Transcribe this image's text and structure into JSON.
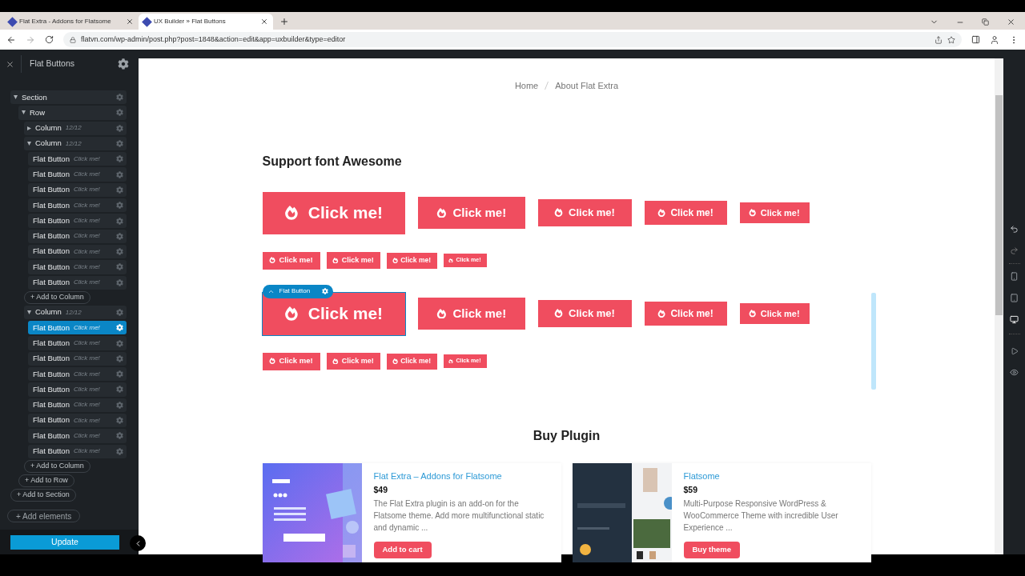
{
  "browser": {
    "tabs": [
      {
        "title": "Flat Extra - Addons for Flatsome",
        "selected": false
      },
      {
        "title": "UX Builder » Flat Buttons",
        "selected": true
      }
    ],
    "url": "flatvn.com/wp-admin/post.php?post=1848&action=edit&app=uxbuilder&type=editor"
  },
  "sidebar": {
    "title": "Flat Buttons",
    "tree": [
      {
        "label": "Section",
        "selected": false,
        "expanded": true,
        "add_label": "+ Add to Section",
        "children": [
          {
            "label": "Row",
            "selected": false,
            "expanded": true,
            "add_label": "+ Add to Row",
            "children": [
              {
                "label": "Column",
                "meta": "12/12",
                "selected": false,
                "expanded": false
              },
              {
                "label": "Column",
                "meta": "12/12",
                "selected": false,
                "expanded": true,
                "add_label": "+ Add to Column",
                "children": [
                  {
                    "label": "Flat Button",
                    "meta": "Click me!",
                    "selected": false
                  },
                  {
                    "label": "Flat Button",
                    "meta": "Click me!",
                    "selected": false
                  },
                  {
                    "label": "Flat Button",
                    "meta": "Click me!",
                    "selected": false
                  },
                  {
                    "label": "Flat Button",
                    "meta": "Click me!",
                    "selected": false
                  },
                  {
                    "label": "Flat Button",
                    "meta": "Click me!",
                    "selected": false
                  },
                  {
                    "label": "Flat Button",
                    "meta": "Click me!",
                    "selected": false
                  },
                  {
                    "label": "Flat Button",
                    "meta": "Click me!",
                    "selected": false
                  },
                  {
                    "label": "Flat Button",
                    "meta": "Click me!",
                    "selected": false
                  },
                  {
                    "label": "Flat Button",
                    "meta": "Click me!",
                    "selected": false
                  }
                ]
              },
              {
                "label": "Column",
                "meta": "12/12",
                "selected": false,
                "expanded": true,
                "add_label": "+ Add to Column",
                "children": [
                  {
                    "label": "Flat Button",
                    "meta": "Click me!",
                    "selected": true
                  },
                  {
                    "label": "Flat Button",
                    "meta": "Click me!",
                    "selected": false
                  },
                  {
                    "label": "Flat Button",
                    "meta": "Click me!",
                    "selected": false
                  },
                  {
                    "label": "Flat Button",
                    "meta": "Click me!",
                    "selected": false
                  },
                  {
                    "label": "Flat Button",
                    "meta": "Click me!",
                    "selected": false
                  },
                  {
                    "label": "Flat Button",
                    "meta": "Click me!",
                    "selected": false
                  },
                  {
                    "label": "Flat Button",
                    "meta": "Click me!",
                    "selected": false
                  },
                  {
                    "label": "Flat Button",
                    "meta": "Click me!",
                    "selected": false
                  },
                  {
                    "label": "Flat Button",
                    "meta": "Click me!",
                    "selected": false
                  }
                ]
              }
            ]
          }
        ]
      }
    ],
    "add_elements": "+ Add elements",
    "update_button": "Update"
  },
  "canvas": {
    "breadcrumb": [
      "Home",
      "About Flat Extra"
    ],
    "heading": "Support font Awesome",
    "selection_label": "Flat Button",
    "button_groups": [
      {
        "large_buttons": [
          {
            "label": "Click me!",
            "selected": false
          },
          {
            "label": "Click me!",
            "selected": false
          },
          {
            "label": "Click me!",
            "selected": false
          },
          {
            "label": "Click me!",
            "selected": false
          },
          {
            "label": "Click me!",
            "selected": false
          }
        ],
        "small_buttons": [
          {
            "label": "Click me!",
            "selected": false
          },
          {
            "label": "Click me!",
            "selected": false
          },
          {
            "label": "Click me!",
            "selected": false
          },
          {
            "label": "Click me!",
            "selected": false
          }
        ]
      },
      {
        "large_buttons": [
          {
            "label": "Click me!",
            "selected": true
          },
          {
            "label": "Click me!",
            "selected": false
          },
          {
            "label": "Click me!",
            "selected": false
          },
          {
            "label": "Click me!",
            "selected": false
          },
          {
            "label": "Click me!",
            "selected": false
          }
        ],
        "small_buttons": [
          {
            "label": "Click me!",
            "selected": false
          },
          {
            "label": "Click me!",
            "selected": false
          },
          {
            "label": "Click me!",
            "selected": false
          },
          {
            "label": "Click me!",
            "selected": false
          }
        ]
      }
    ],
    "buy_heading": "Buy Plugin",
    "products": [
      {
        "title": "Flat Extra – Addons for Flatsome",
        "price": "$49",
        "description": "The Flat Extra plugin is an add-on for the Flatsome theme. Add more multifunctional static and dynamic ...",
        "button": "Add to cart",
        "kind": "picture"
      },
      {
        "title": "Flatsome",
        "price": "$59",
        "description": "Multi-Purpose Responsive WordPress & WooCommerce Theme with incredible User Experience ...",
        "button": "Buy theme",
        "kind": "picture"
      }
    ]
  },
  "toolbar": {
    "devices": [
      {
        "kind": "mobile",
        "selected": false
      },
      {
        "kind": "tablet",
        "selected": false
      },
      {
        "kind": "desktop",
        "selected": true
      }
    ]
  }
}
